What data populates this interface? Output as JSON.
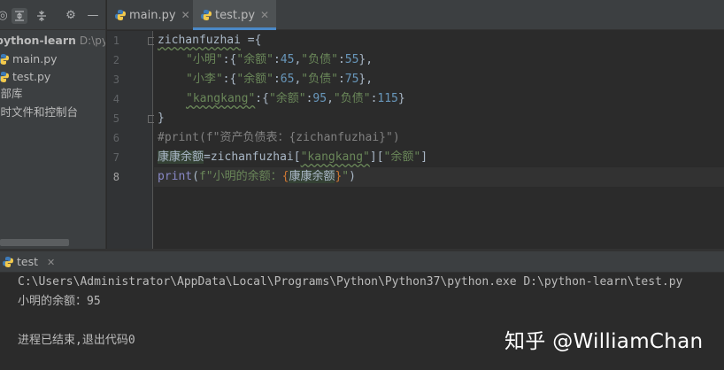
{
  "project_panel": {
    "toolbar_icons": [
      "target-icon",
      "expand-all-icon",
      "collapse-all-icon",
      "gear-icon",
      "minimize-icon"
    ],
    "root_label": "python-learn",
    "root_path": "D:\\pyth",
    "files": [
      "main.py",
      "test.py"
    ],
    "external_libs": "外部库",
    "scratches": "临时文件和控制台"
  },
  "editor": {
    "tabs": [
      {
        "label": "main.py",
        "active": false
      },
      {
        "label": "test.py",
        "active": true
      }
    ],
    "line_numbers": [
      "1",
      "2",
      "3",
      "4",
      "5",
      "6",
      "7",
      "8"
    ],
    "current_line": "8",
    "code": {
      "l1_var": "zichanfuzhai",
      "l1_op": " ={",
      "l2_key": "\"小明\"",
      "l2_a": ":{",
      "l2_k1": "\"余额\"",
      "l2_c1": ":",
      "l2_v1": "45",
      "l2_comma": ",",
      "l2_k2": "\"负债\"",
      "l2_c2": ":",
      "l2_v2": "55",
      "l2_end": "},",
      "l3_key": "\"小李\"",
      "l3_a": ":{",
      "l3_k1": "\"余额\"",
      "l3_c1": ":",
      "l3_v1": "65",
      "l3_comma": ",",
      "l3_k2": "\"负债\"",
      "l3_c2": ":",
      "l3_v2": "75",
      "l3_end": "},",
      "l4_key": "\"kangkang\"",
      "l4_a": ":{",
      "l4_k1": "\"余额\"",
      "l4_c1": ":",
      "l4_v1": "95",
      "l4_comma": ",",
      "l4_k2": "\"负债\"",
      "l4_c2": ":",
      "l4_v2": "115",
      "l4_end": "}",
      "l5": "}",
      "l6": "#print(f\"资产负债表：{zichanfuzhai}\")",
      "l7_var": "康康余额",
      "l7_eq": "=zichanfuzhai[",
      "l7_k1": "\"kangkang\"",
      "l7_mid": "][",
      "l7_k2": "\"余额\"",
      "l7_end": "]",
      "l8_fn": "print",
      "l8_open": "(",
      "l8_str1": "f\"小明的余额：",
      "l8_brace_open": "{",
      "l8_var": "康康余额",
      "l8_brace_close": "}",
      "l8_str2": "\"",
      "l8_close": ")"
    }
  },
  "run_panel": {
    "tab_label": "test",
    "lines": [
      "C:\\Users\\Administrator\\AppData\\Local\\Programs\\Python\\Python37\\python.exe D:\\python-learn\\test.py",
      "小明的余额：95",
      "",
      "进程已结束,退出代码0"
    ]
  },
  "watermark": "知乎 @WilliamChan",
  "colors": {
    "background": "#2b2b2b",
    "panel": "#3c3f41",
    "string": "#6a8759",
    "number": "#6897bb",
    "comment": "#808080",
    "builtin": "#8888c6",
    "text": "#a9b7c6",
    "accent": "#4a88c7"
  }
}
